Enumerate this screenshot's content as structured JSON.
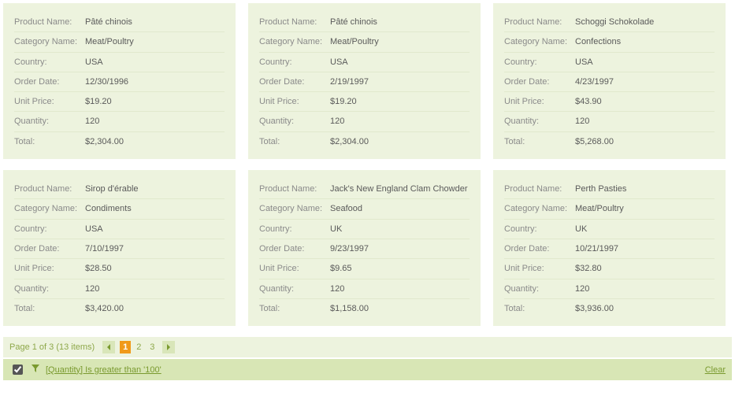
{
  "labels": {
    "product": "Product Name:",
    "category": "Category Name:",
    "country": "Country:",
    "orderDate": "Order Date:",
    "unitPrice": "Unit Price:",
    "quantity": "Quantity:",
    "total": "Total:"
  },
  "cards": [
    {
      "product": "Pâté chinois",
      "category": "Meat/Poultry",
      "country": "USA",
      "orderDate": "12/30/1996",
      "unitPrice": "$19.20",
      "quantity": "120",
      "total": "$2,304.00"
    },
    {
      "product": "Pâté chinois",
      "category": "Meat/Poultry",
      "country": "USA",
      "orderDate": "2/19/1997",
      "unitPrice": "$19.20",
      "quantity": "120",
      "total": "$2,304.00"
    },
    {
      "product": "Schoggi Schokolade",
      "category": "Confections",
      "country": "USA",
      "orderDate": "4/23/1997",
      "unitPrice": "$43.90",
      "quantity": "120",
      "total": "$5,268.00"
    },
    {
      "product": "Sirop d'érable",
      "category": "Condiments",
      "country": "USA",
      "orderDate": "7/10/1997",
      "unitPrice": "$28.50",
      "quantity": "120",
      "total": "$3,420.00"
    },
    {
      "product": "Jack's New England Clam Chowder",
      "category": "Seafood",
      "country": "UK",
      "orderDate": "9/23/1997",
      "unitPrice": "$9.65",
      "quantity": "120",
      "total": "$1,158.00"
    },
    {
      "product": "Perth Pasties",
      "category": "Meat/Poultry",
      "country": "UK",
      "orderDate": "10/21/1997",
      "unitPrice": "$32.80",
      "quantity": "120",
      "total": "$3,936.00"
    }
  ],
  "pager": {
    "info": "Page 1 of 3 (13 items)",
    "pages": [
      "1",
      "2",
      "3"
    ],
    "current": 0
  },
  "filter": {
    "checked": true,
    "text": "[Quantity] Is greater than '100'",
    "clear": "Clear"
  }
}
